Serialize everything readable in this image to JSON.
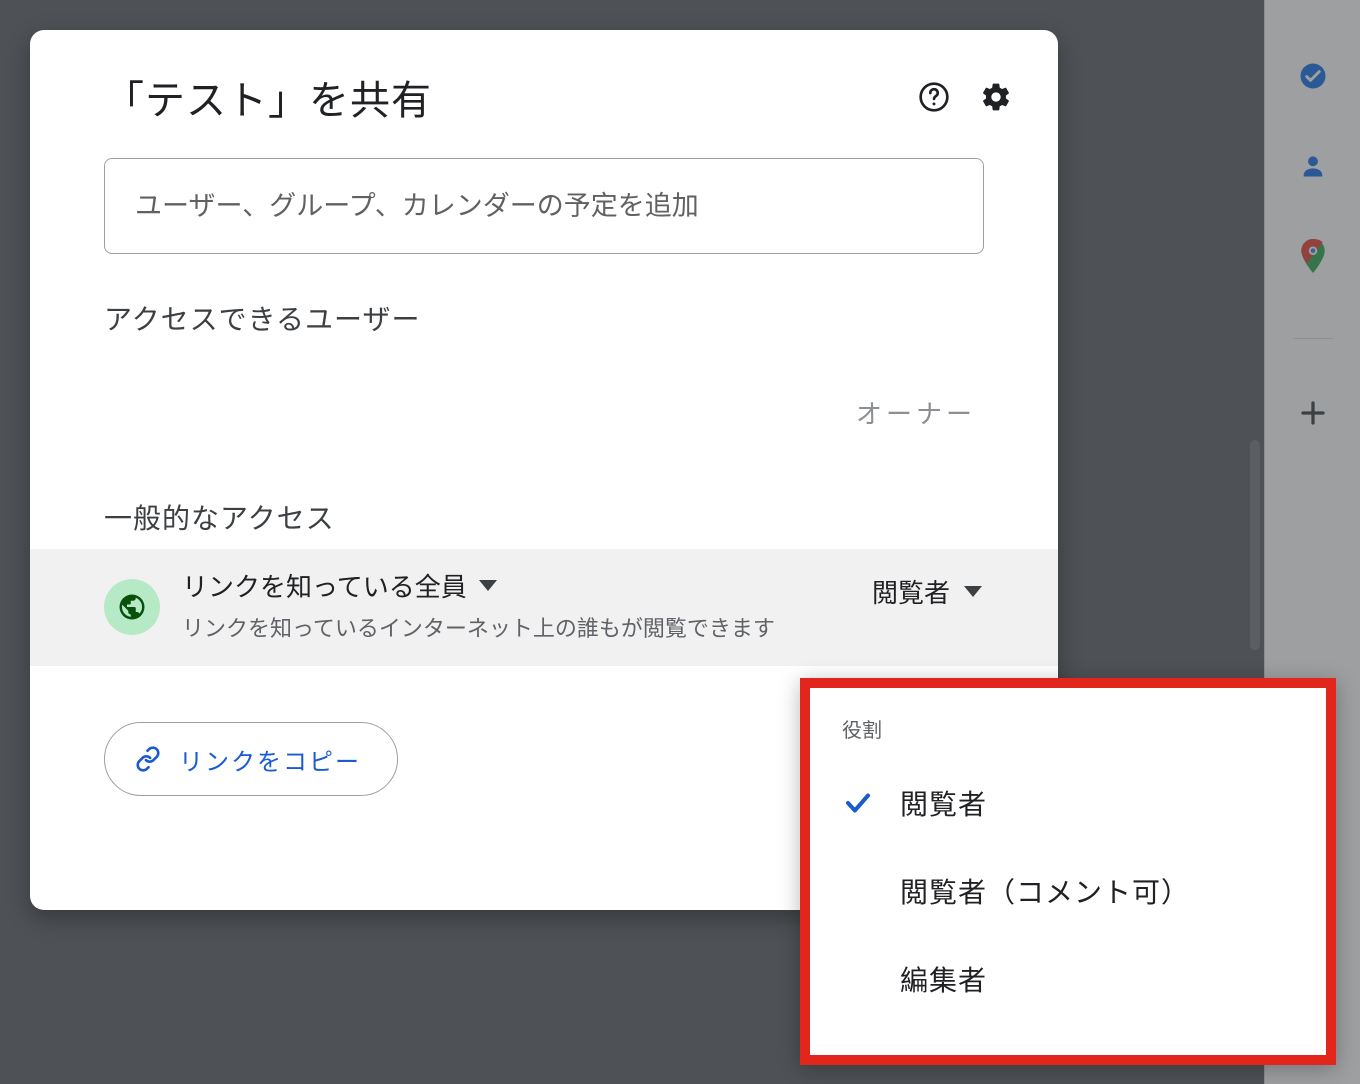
{
  "dialog": {
    "title": "「テスト」を共有",
    "help_icon": "help-icon",
    "settings_icon": "gear-icon",
    "add_people_placeholder": "ユーザー、グループ、カレンダーの予定を追加",
    "access_section_label": "アクセスできるユーザー",
    "owner_label": "オーナー",
    "general_access_label": "一般的なアクセス",
    "general_access": {
      "scope_label": "リンクを知っている全員",
      "description": "リンクを知っているインターネット上の誰もが閲覧できます",
      "role_selected": "閲覧者"
    },
    "copy_link_label": "リンクをコピー"
  },
  "role_menu": {
    "label": "役割",
    "items": [
      {
        "label": "閲覧者",
        "selected": true
      },
      {
        "label": "閲覧者（コメント可）",
        "selected": false
      },
      {
        "label": "編集者",
        "selected": false
      }
    ]
  },
  "side_rail": {
    "items": [
      "tasks",
      "contacts",
      "maps",
      "add"
    ]
  }
}
